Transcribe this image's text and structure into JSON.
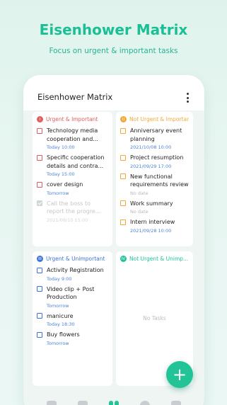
{
  "hero": {
    "title": "Eisenhower Matrix",
    "subtitle": "Focus on urgent & important tasks"
  },
  "app": {
    "title": "Eisenhower Matrix"
  },
  "colors": {
    "accent": "#21c397",
    "q1": "#e35d5d",
    "q2": "#f2a93b",
    "q3": "#3f74d8",
    "q4": "#21c397",
    "date_blue": "#4d83d6"
  },
  "quadrants": [
    {
      "badge": "I",
      "label": "Urgent & Important",
      "tasks": [
        {
          "title": "Technology media cooperation and...",
          "date": "Today 10:00",
          "done": false
        },
        {
          "title": "Specific cooperation details and contra...",
          "date": "Today 15:00",
          "done": false
        },
        {
          "title": "cover design",
          "date": "Tomorrow",
          "done": false
        },
        {
          "title": "Call the boss to report the progre...",
          "date": "2021/09/10 15:00",
          "done": true
        }
      ]
    },
    {
      "badge": "II",
      "label": "Not Urgent & Important",
      "tasks": [
        {
          "title": "Anniversary event planning",
          "date": "2021/10/08 10:00",
          "done": false
        },
        {
          "title": "Project resumption",
          "date": "2021/09/29 17:00",
          "done": false
        },
        {
          "title": "New functional requirements review",
          "date": "No date",
          "done": false
        },
        {
          "title": "Work summary",
          "date": "No date",
          "done": false
        },
        {
          "title": "Intern interview",
          "date": "2021/09/28 10:00",
          "done": false
        }
      ]
    },
    {
      "badge": "III",
      "label": "Urgent & Unimportant",
      "tasks": [
        {
          "title": "Activity Registration",
          "date": "Today 9:00",
          "done": false
        },
        {
          "title": "Video clip + Post Production",
          "date": "Tomorrow",
          "done": false
        },
        {
          "title": "manicure",
          "date": "Today 18:30",
          "done": false
        },
        {
          "title": "Buy flowers",
          "date": "Tomorrow",
          "done": false
        }
      ]
    },
    {
      "badge": "IV",
      "label": "Not Urgent & Unimp...",
      "empty_text": "No Tasks",
      "tasks": []
    }
  ],
  "fab": {
    "icon": "plus-icon",
    "label": "+"
  },
  "nav": [
    "list-icon",
    "calendar-icon",
    "matrix-icon",
    "timer-icon",
    "home-icon"
  ]
}
